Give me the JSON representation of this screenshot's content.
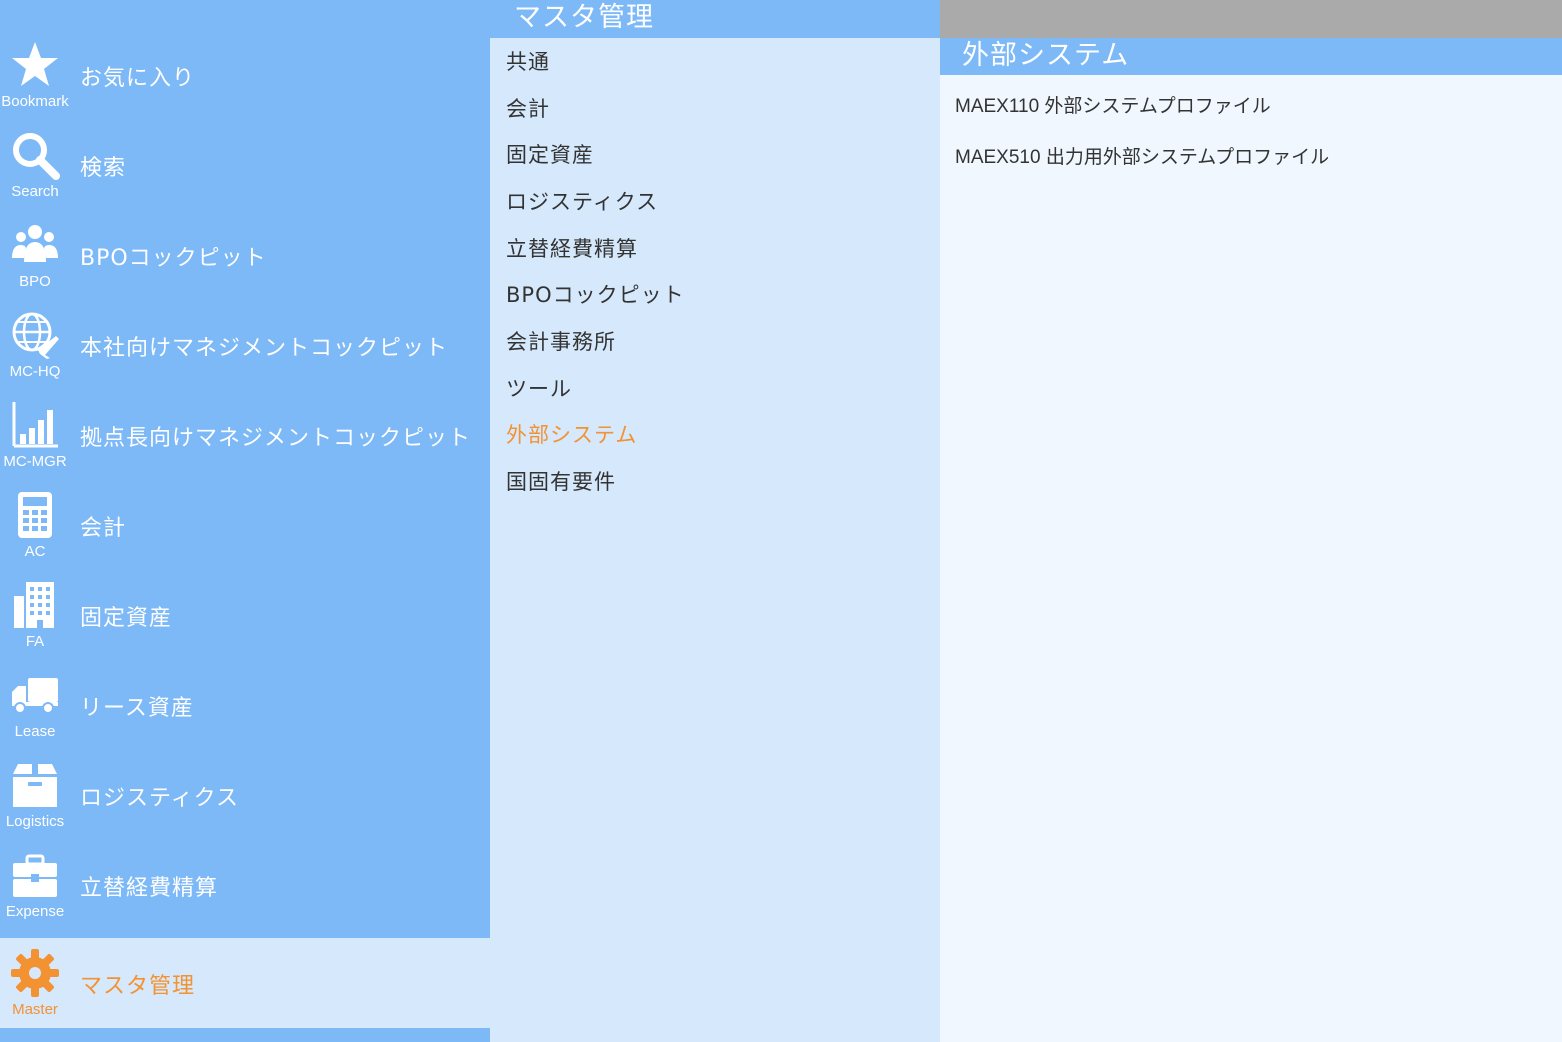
{
  "nav": {
    "items": [
      {
        "short": "Bookmark",
        "label": "お気に入り",
        "icon": "star-icon"
      },
      {
        "short": "Search",
        "label": "検索",
        "icon": "search-icon"
      },
      {
        "short": "BPO",
        "label": "BPOコックピット",
        "icon": "users-icon"
      },
      {
        "short": "MC-HQ",
        "label": "本社向けマネジメントコックピット",
        "icon": "globe-plane-icon"
      },
      {
        "short": "MC-MGR",
        "label": "拠点長向けマネジメントコックピット",
        "icon": "bar-chart-icon"
      },
      {
        "short": "AC",
        "label": "会計",
        "icon": "calculator-icon"
      },
      {
        "short": "FA",
        "label": "固定資産",
        "icon": "building-icon"
      },
      {
        "short": "Lease",
        "label": "リース資産",
        "icon": "truck-icon"
      },
      {
        "short": "Logistics",
        "label": "ロジスティクス",
        "icon": "box-icon"
      },
      {
        "short": "Expense",
        "label": "立替経費精算",
        "icon": "briefcase-icon"
      },
      {
        "short": "Master",
        "label": "マスタ管理",
        "icon": "gear-icon",
        "active": true
      }
    ]
  },
  "middle": {
    "title": "マスタ管理",
    "items": [
      {
        "label": "共通"
      },
      {
        "label": "会計"
      },
      {
        "label": "固定資産"
      },
      {
        "label": "ロジスティクス"
      },
      {
        "label": "立替経費精算"
      },
      {
        "label": "BPOコックピット"
      },
      {
        "label": "会計事務所"
      },
      {
        "label": "ツール"
      },
      {
        "label": "外部システム",
        "active": true
      },
      {
        "label": "国固有要件"
      }
    ]
  },
  "right": {
    "title": "外部システム",
    "items": [
      {
        "code": "MAEX110",
        "name": "外部システムプロファイル"
      },
      {
        "code": "MAEX510",
        "name": "出力用外部システムプロファイル"
      }
    ]
  },
  "colors": {
    "nav_bg": "#7db8f7",
    "pane_bg": "#d6e8fb",
    "content_bg": "#f0f7fe",
    "accent": "#f39232",
    "topbar": "#aaaaaa",
    "text": "#333333"
  }
}
